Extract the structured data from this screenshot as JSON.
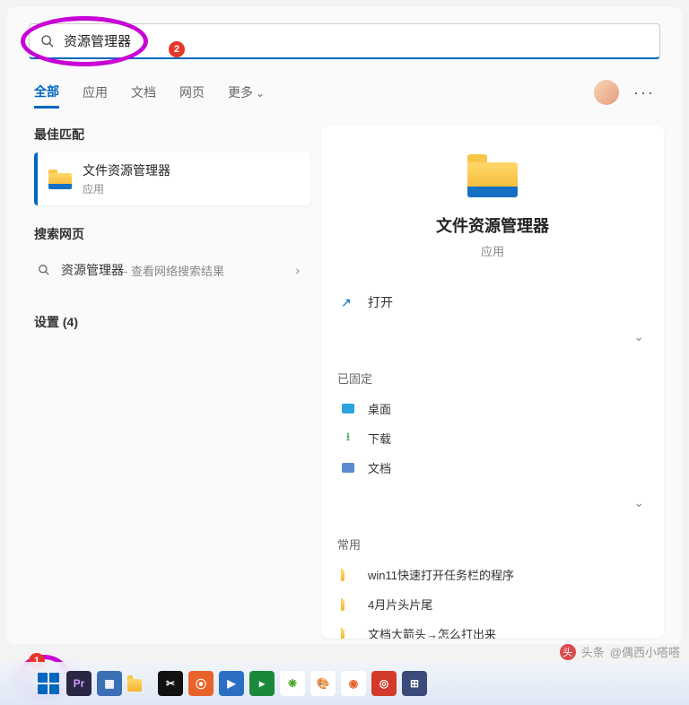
{
  "search": {
    "value": "资源管理器"
  },
  "annotations": {
    "badge1": "1",
    "badge2": "2"
  },
  "tabs": {
    "items": [
      "全部",
      "应用",
      "文档",
      "网页",
      "更多"
    ],
    "active_index": 0
  },
  "left": {
    "best_match_header": "最佳匹配",
    "best_match": {
      "title": "文件资源管理器",
      "subtitle": "应用"
    },
    "web_header": "搜索网页",
    "web_row": {
      "term": "资源管理器",
      "suffix": " - 查看网络搜索结果"
    },
    "settings_row": "设置 (4)"
  },
  "preview": {
    "title": "文件资源管理器",
    "subtitle": "应用",
    "open_label": "打开",
    "pinned_header": "已固定",
    "pinned": [
      {
        "label": "桌面",
        "color": "#2aa3e0"
      },
      {
        "label": "下载",
        "icon": "download",
        "color": "#2e9a4f"
      },
      {
        "label": "文档",
        "color": "#5b8bd4"
      }
    ],
    "frequent_header": "常用",
    "frequent": [
      {
        "label": "win11快速打开任务栏的程序"
      },
      {
        "label": "4月片头片尾"
      },
      {
        "label": "文档大箭头→怎么打出来"
      }
    ]
  },
  "taskbar": {
    "icons": [
      {
        "name": "start",
        "type": "winlogo"
      },
      {
        "name": "premiere",
        "bg": "#2a2745",
        "fg": "#d49cff",
        "txt": "Pr"
      },
      {
        "name": "calculator",
        "bg": "#3b6fb5",
        "fg": "#fff",
        "txt": "▦"
      },
      {
        "name": "explorer",
        "type": "folder"
      },
      {
        "name": "capcut",
        "bg": "#111",
        "fg": "#fff",
        "txt": "✂"
      },
      {
        "name": "app-orange",
        "bg": "#e8632a",
        "fg": "#fff",
        "txt": "⦿"
      },
      {
        "name": "video",
        "bg": "#2a6fc4",
        "fg": "#fff",
        "txt": "▶"
      },
      {
        "name": "media",
        "bg": "#1a8a3a",
        "fg": "#fff",
        "txt": "▸"
      },
      {
        "name": "evernote",
        "bg": "#fff",
        "fg": "#4aa82a",
        "txt": "❋"
      },
      {
        "name": "paint",
        "bg": "#fff",
        "fg": "#2a8ad4",
        "txt": "🎨"
      },
      {
        "name": "firefox",
        "bg": "#fff",
        "fg": "#e8632a",
        "txt": "◉"
      },
      {
        "name": "app-red",
        "bg": "#d43a2a",
        "fg": "#fff",
        "txt": "◎"
      },
      {
        "name": "grid",
        "bg": "#3a4a7a",
        "fg": "#fff",
        "txt": "⊞"
      }
    ]
  },
  "watermark": {
    "prefix": "头条",
    "author": "@偶西小嗒嗒"
  }
}
